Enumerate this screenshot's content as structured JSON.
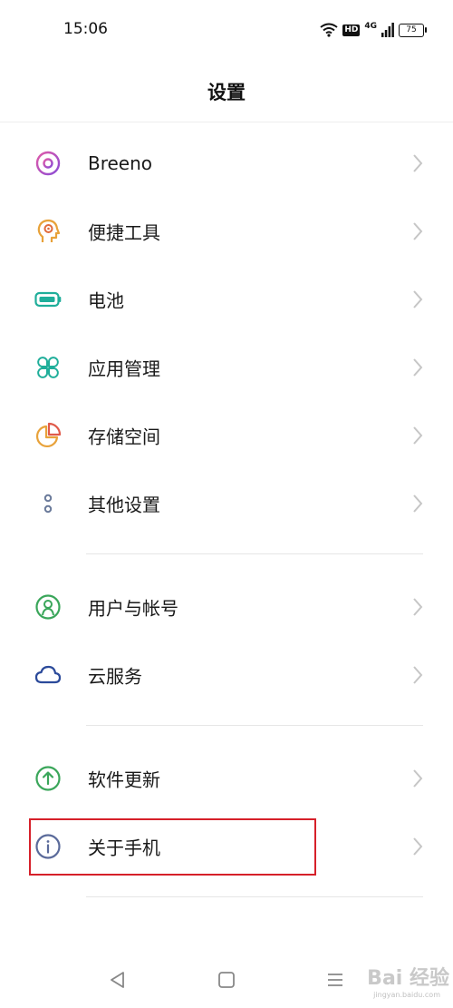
{
  "status_bar": {
    "time": "15:06",
    "hd_label": "HD",
    "network_label": "4G",
    "battery_level": "75"
  },
  "header": {
    "title": "设置"
  },
  "groups": [
    {
      "items": [
        {
          "label": "Breeno",
          "icon": "breeno-icon",
          "color": "#c44bbf"
        },
        {
          "label": "便捷工具",
          "icon": "convenience-tools-icon",
          "color": "#e8a23a"
        },
        {
          "label": "电池",
          "icon": "battery-icon",
          "color": "#1fae9a"
        },
        {
          "label": "应用管理",
          "icon": "app-management-icon",
          "color": "#1fae9a"
        },
        {
          "label": "存储空间",
          "icon": "storage-icon",
          "color": "#e8a23a"
        },
        {
          "label": "其他设置",
          "icon": "other-settings-icon",
          "color": "#6a7a9a"
        }
      ]
    },
    {
      "items": [
        {
          "label": "用户与帐号",
          "icon": "user-account-icon",
          "color": "#3aa65a"
        },
        {
          "label": "云服务",
          "icon": "cloud-icon",
          "color": "#2b4a9a"
        }
      ]
    },
    {
      "items": [
        {
          "label": "软件更新",
          "icon": "software-update-icon",
          "color": "#3aa65a"
        },
        {
          "label": "关于手机",
          "icon": "about-phone-icon",
          "color": "#5a6a9a"
        }
      ]
    }
  ],
  "highlight_color": "#d6202a",
  "watermark": {
    "text": "Bai 经验",
    "sub": "jingyan.baidu.com"
  }
}
